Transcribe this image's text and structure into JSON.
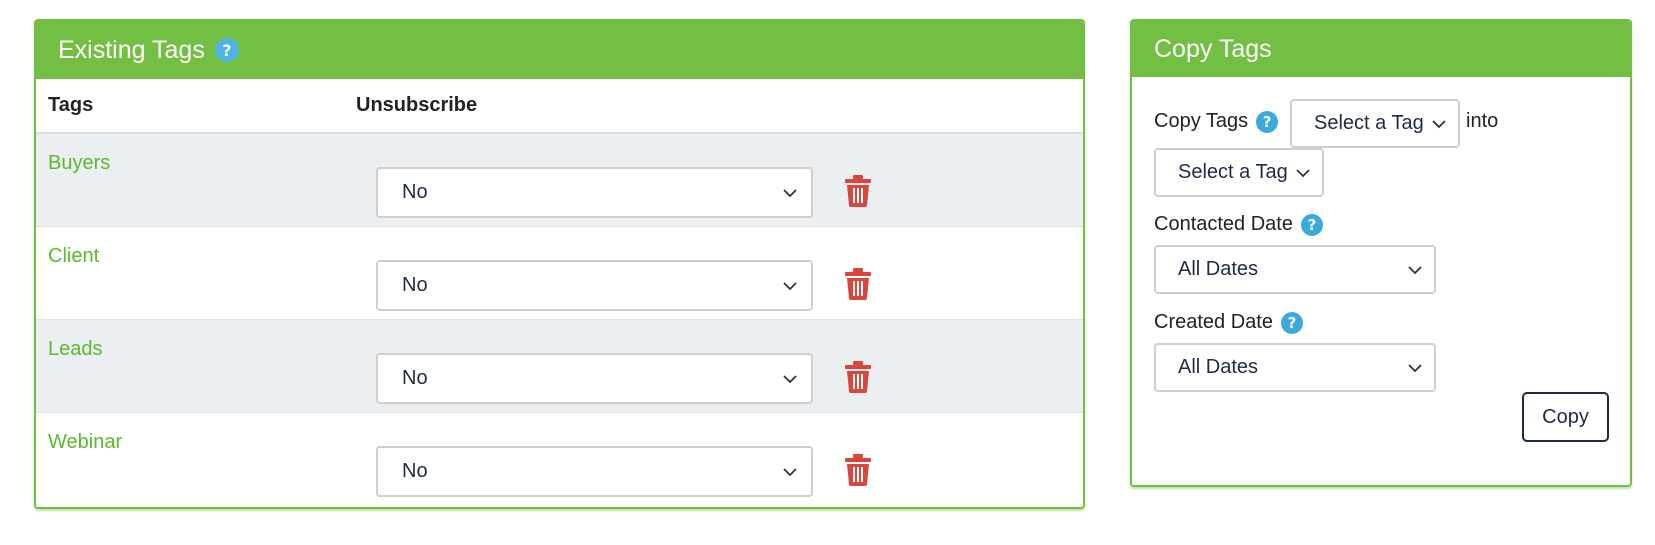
{
  "existing_tags": {
    "title": "Existing Tags",
    "help_icon": "question-circle-icon",
    "columns": {
      "tags": "Tags",
      "unsubscribe": "Unsubscribe"
    },
    "rows": [
      {
        "name": "Buyers",
        "unsubscribe": "No"
      },
      {
        "name": "Client",
        "unsubscribe": "No"
      },
      {
        "name": "Leads",
        "unsubscribe": "No"
      },
      {
        "name": "Webinar",
        "unsubscribe": "No"
      }
    ],
    "delete_icon": "trash-icon"
  },
  "copy_tags": {
    "title": "Copy Tags",
    "copy_label": "Copy Tags",
    "source_select": "Select a Tag",
    "into_label": "into",
    "target_select": "Select a Tag",
    "contacted_label": "Contacted Date",
    "contacted_select": "All Dates",
    "created_label": "Created Date",
    "created_select": "All Dates",
    "copy_button": "Copy"
  },
  "colors": {
    "brand_green": "#72bf44",
    "tag_link": "#5cb82c",
    "help_blue": "#3aa9dc",
    "delete_red": "#d9463e",
    "button_navy": "#1f2a44"
  }
}
